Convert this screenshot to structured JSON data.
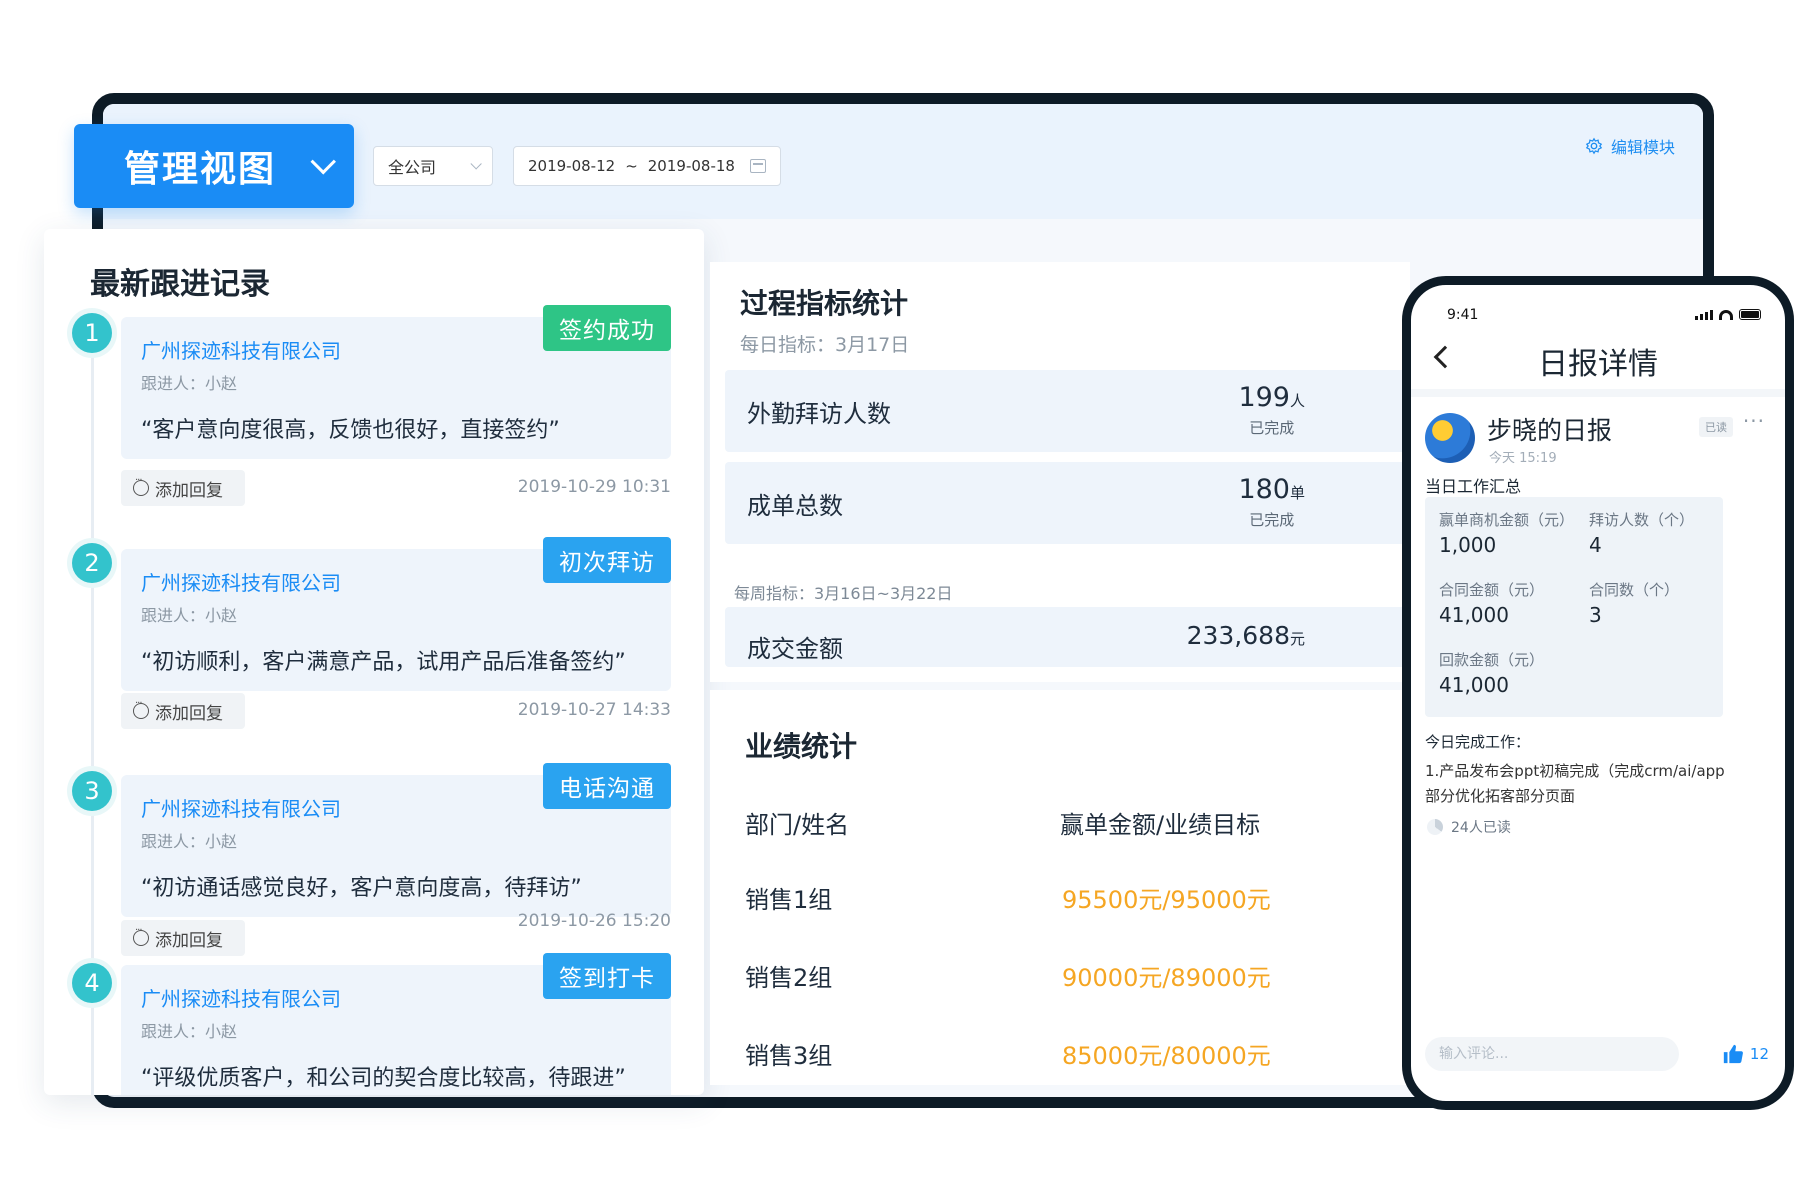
{
  "header": {
    "view_title": "管理视图",
    "company_select": "全公司",
    "date_start": "2019-08-12",
    "date_sep": "~",
    "date_end": "2019-08-18",
    "edit_module": "编辑模块",
    "accent": "#1a8cf5"
  },
  "records": {
    "title": "最新跟进记录",
    "reply_label": "添加回复",
    "items": [
      {
        "num": "1",
        "company": "广州探迹科技有限公司",
        "owner": "跟进人：小赵",
        "quote": "“客户意向度很高，反馈也很好，直接签约”",
        "tag": "签约成功",
        "tag_color": "#2ec586",
        "time": "2019-10-29 10:31"
      },
      {
        "num": "2",
        "company": "广州探迹科技有限公司",
        "owner": "跟进人：小赵",
        "quote": "“初访顺利，客户满意产品，试用产品后准备签约”",
        "tag": "初次拜访",
        "tag_color": "#2aa3f0",
        "time": "2019-10-27 14:33"
      },
      {
        "num": "3",
        "company": "广州探迹科技有限公司",
        "owner": "跟进人：小赵",
        "quote": "“初访通话感觉良好，客户意向度高，待拜访”",
        "tag": "电话沟通",
        "tag_color": "#2aa3f0",
        "time": "2019-10-26 15:20"
      },
      {
        "num": "4",
        "company": "广州探迹科技有限公司",
        "owner": "跟进人：小赵",
        "quote": "“评级优质客户，和公司的契合度比较高，待跟进”",
        "tag": "签到打卡",
        "tag_color": "#2aa3f0"
      }
    ]
  },
  "process": {
    "title": "过程指标统计",
    "daily": "每日指标：3月17日",
    "rows": [
      {
        "label": "外勤拜访人数",
        "value": "199",
        "unit": "人",
        "status": "已完成"
      },
      {
        "label": "成单总数",
        "value": "180",
        "unit": "单",
        "status": "已完成"
      }
    ],
    "weekly": "每周指标：3月16日~3月22日",
    "weekly_row": {
      "label": "成交金额",
      "value": "233,688",
      "unit": "元"
    }
  },
  "performance": {
    "title": "业绩统计",
    "col_name": "部门/姓名",
    "col_value": "赢单金额/业绩目标",
    "rows": [
      {
        "name": "销售1组",
        "value": "95500元/95000元"
      },
      {
        "name": "销售2组",
        "value": "90000元/89000元"
      },
      {
        "name": "销售3组",
        "value": "85000元/80000元"
      }
    ],
    "value_color": "#f5a623"
  },
  "phone": {
    "time": "9:41",
    "title": "日报详情",
    "author": "步晓的日报",
    "author_time": "今天 15:19",
    "read_badge": "已读",
    "more": "···",
    "summary_title": "当日工作汇总",
    "summary": [
      {
        "label": "赢单商机金额（元）",
        "value": "1,000"
      },
      {
        "label": "拜访人数（个）",
        "value": "4"
      },
      {
        "label": "合同金额（元）",
        "value": "41,000"
      },
      {
        "label": "合同数（个）",
        "value": "3"
      },
      {
        "label": "回款金额（元）",
        "value": "41,000"
      }
    ],
    "done_title": "今日完成工作：",
    "done_text": "1.产品发布会ppt初稿完成（完成crm/ai/app部分优化拓客部分页面",
    "readers": "24人已读",
    "comment_placeholder": "输入评论...",
    "likes": "12"
  }
}
